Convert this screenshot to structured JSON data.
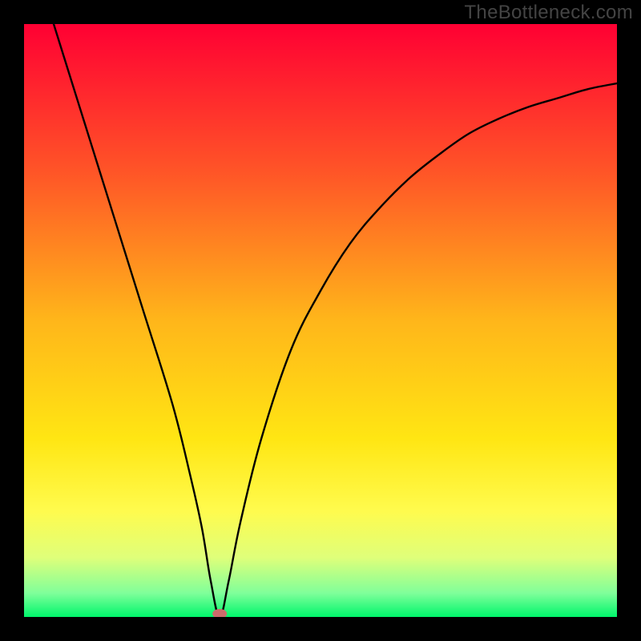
{
  "watermark": "TheBottleneck.com",
  "chart_data": {
    "type": "line",
    "title": "",
    "xlabel": "",
    "ylabel": "",
    "xlim": [
      0,
      100
    ],
    "ylim": [
      0,
      100
    ],
    "background": {
      "type": "vertical-gradient",
      "stops": [
        {
          "pct": 0,
          "color": "#ff0033"
        },
        {
          "pct": 25,
          "color": "#ff5527"
        },
        {
          "pct": 50,
          "color": "#ffb61a"
        },
        {
          "pct": 70,
          "color": "#ffe613"
        },
        {
          "pct": 82,
          "color": "#fffb4d"
        },
        {
          "pct": 90,
          "color": "#dfff7a"
        },
        {
          "pct": 96,
          "color": "#7fff9a"
        },
        {
          "pct": 100,
          "color": "#00f56b"
        }
      ]
    },
    "series": [
      {
        "name": "bottleneck-curve",
        "color": "#000000",
        "x": [
          5,
          10,
          15,
          20,
          25,
          28,
          30,
          31.5,
          33,
          34.5,
          36.5,
          40,
          45,
          50,
          55,
          60,
          65,
          70,
          75,
          80,
          85,
          90,
          95,
          100
        ],
        "y": [
          100,
          84,
          68,
          52,
          36,
          24,
          15,
          6,
          0,
          6,
          16,
          30,
          45,
          55,
          63,
          69,
          74,
          78,
          81.5,
          84,
          86,
          87.5,
          89,
          90
        ]
      }
    ],
    "marker": {
      "x": 33,
      "y": 0,
      "color": "#cc6b6b"
    }
  }
}
